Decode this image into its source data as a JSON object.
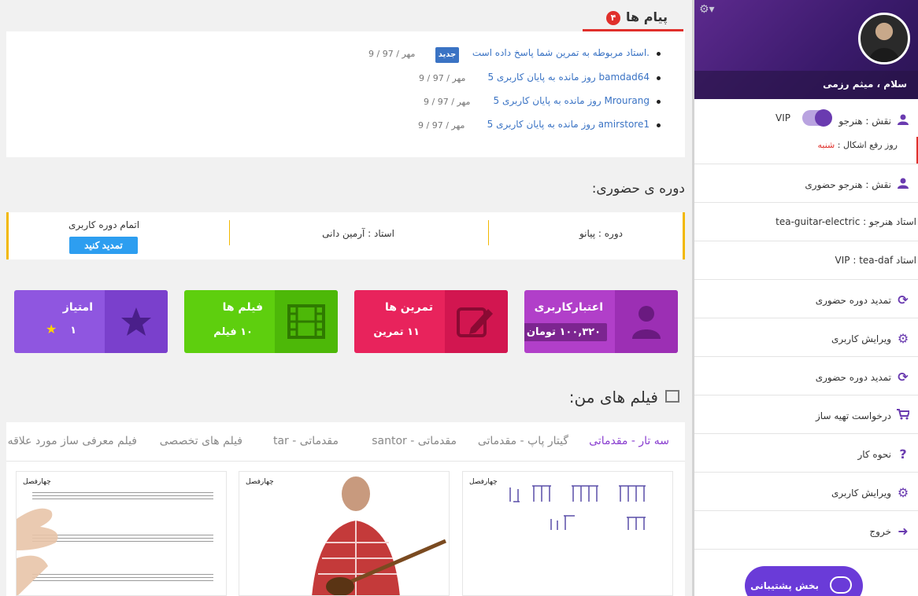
{
  "messages": {
    "title": "پیام ها",
    "count": "۴",
    "new_badge": "جدید",
    "items": [
      {
        "text": "استاد مربوطه به تمرین شما پاسخ داده است.",
        "date": "9 / مهر / 97"
      },
      {
        "text": "5 روز مانده به پایان کاربری bamdad64",
        "date": "9 / مهر / 97"
      },
      {
        "text": "5 روز مانده به پایان کاربری Mrourang",
        "date": "9 / مهر / 97"
      },
      {
        "text": "5 روز مانده به پایان کاربری amirstore1",
        "date": "9 / مهر / 97"
      }
    ]
  },
  "inperson": {
    "title": "دوره ی حضوری:",
    "course": "دوره : پیانو",
    "teacher": "استاد : آرمین دانی",
    "end_label": "اتمام دوره کاربری",
    "renew_button": "تمدید کنید"
  },
  "stats": {
    "credit": {
      "title": "اعتبارکاربری",
      "value": "۱۰۰,۳۲۰ تومان",
      "color": "#b13fc9"
    },
    "exercises": {
      "title": "تمرین ها",
      "value": "۱۱ تمرین",
      "color": "#e8235c"
    },
    "films": {
      "title": "فیلم ها",
      "value": "۱۰ فیلم",
      "color": "#5ecf0e"
    },
    "score": {
      "title": "امتیاز",
      "value": "۱",
      "color": "#8f56e0"
    }
  },
  "films": {
    "title": "فیلم های من:",
    "tabs": [
      "سه تار - مقدماتی",
      "گیتار پاپ - مقدماتی",
      "santor - مقدماتی",
      "tar - مقدماتی",
      "فیلم های تخصصی",
      "فیلم معرفی ساز مورد علاقه"
    ],
    "thumb_logo": "چهارفصل"
  },
  "sidebar": {
    "greeting": "سلام ، میثم رزمی",
    "role_vip": "نقش : هنرجو",
    "vip_label": "VIP",
    "holiday_label": "روز رفع اشکال :",
    "holiday_day": "شنبه",
    "items": [
      {
        "label": "نقش : هنرجو حضوری",
        "icon": "user-icon"
      },
      {
        "label": "استاد هنرجو : tea-guitar-electric",
        "icon": ""
      },
      {
        "label": "استاد VIP : tea-daf",
        "icon": ""
      },
      {
        "label": "تمدید دوره حضوری",
        "icon": "refresh-icon"
      },
      {
        "label": "ویرایش کاربری",
        "icon": "gear-icon"
      },
      {
        "label": "تمدید دوره حضوری",
        "icon": "refresh-icon"
      },
      {
        "label": "درخواست تهیه ساز",
        "icon": "cart-icon"
      },
      {
        "label": "نحوه کار",
        "icon": "question-icon"
      },
      {
        "label": "ویرایش کاربری",
        "icon": "gear-icon"
      },
      {
        "label": "خروج",
        "icon": "logout-icon"
      }
    ]
  },
  "support": {
    "label": "بخش پشتیبانی"
  }
}
